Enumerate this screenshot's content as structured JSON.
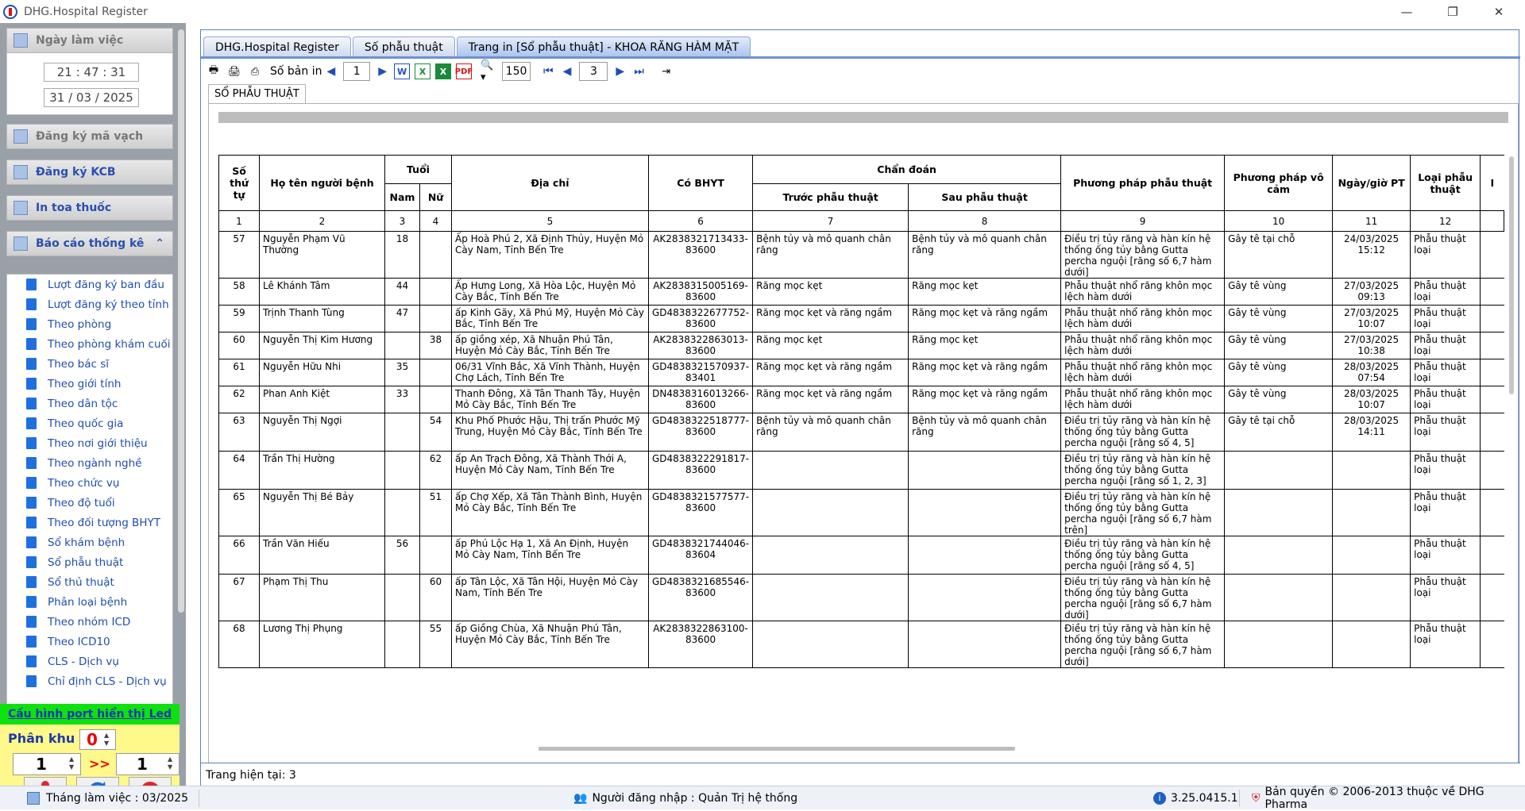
{
  "window": {
    "title": "DHG.Hospital Register",
    "controls": {
      "minimize": "—",
      "maximize": "❐",
      "close": "✕"
    }
  },
  "left": {
    "working_day_header": "Ngày làm việc",
    "time": "21 : 47 : 31",
    "date": "31 / 03 / 2025",
    "barcode_header": "Đăng ký mã vạch",
    "kcb_header": "Đăng ký KCB",
    "prescription_header": "In toa thuốc",
    "report_header": "Báo cáo thống kê",
    "report_items": [
      {
        "label": "Lượt đăng ký ban đầu"
      },
      {
        "label": "Lượt đăng ký theo tỉnh"
      },
      {
        "label": "Theo phòng"
      },
      {
        "label": "Theo phòng khám cuối"
      },
      {
        "label": "Theo bác sĩ"
      },
      {
        "label": "Theo giới tính"
      },
      {
        "label": "Theo dân tộc"
      },
      {
        "label": "Theo quốc gia"
      },
      {
        "label": "Theo nơi giới thiệu"
      },
      {
        "label": "Theo ngành nghề"
      },
      {
        "label": "Theo chức vụ"
      },
      {
        "label": "Theo độ tuổi"
      },
      {
        "label": "Theo đối tượng BHYT"
      },
      {
        "label": "Sổ khám bệnh"
      },
      {
        "label": "Sổ phẫu thuật"
      },
      {
        "label": "Sổ thủ thuật"
      },
      {
        "label": "Phân loại bệnh"
      },
      {
        "label": "Theo nhóm ICD"
      },
      {
        "label": "Theo ICD10"
      },
      {
        "label": "CLS - Dịch vụ"
      },
      {
        "label": "Chỉ định CLS - Dịch vụ"
      }
    ],
    "led_link": "Cấu hình port hiển thị Led",
    "phan_khu_label": "Phân khu :",
    "phan_khu_value": "0",
    "from_value": "1",
    "arrow_text": ">>",
    "to_value": "1"
  },
  "tabs": [
    {
      "label": "DHG.Hospital Register"
    },
    {
      "label": "Số phẫu thuật"
    },
    {
      "label": "Trang in [Sổ phẫu thuật] - KHOA RĂNG HÀM MẶT"
    }
  ],
  "toolbar": {
    "copies_label": "Số bản in",
    "copies_value": "1",
    "zoom_value": "150",
    "page_value": "3"
  },
  "subtab_label": "SỔ PHẪU THUẬT",
  "report": {
    "headers": {
      "stt": "Số thứ tự",
      "name": "Họ tên người bệnh",
      "age": "Tuổi",
      "male": "Nam",
      "female": "Nữ",
      "address": "Địa chỉ",
      "bhyt": "Có BHYT",
      "diagnosis": "Chẩn đoán",
      "before": "Trước phẫu thuật",
      "after": "Sau phẫu thuật",
      "method": "Phương pháp phẫu thuật",
      "anesthesia": "Phương pháp vô cảm",
      "datetime": "Ngày/giờ PT",
      "type": "Loại phẫu thuật",
      "extra": "I"
    },
    "col_numbers": [
      "1",
      "2",
      "3",
      "4",
      "5",
      "6",
      "7",
      "8",
      "9",
      "10",
      "11",
      "12",
      ""
    ],
    "rows": [
      {
        "stt": "57",
        "name": "Nguyễn Phạm Vũ Thường",
        "male": "18",
        "female": "",
        "address": "Ấp Hoà Phú 2, Xã Định Thủy, Huyện Mỏ Cày Nam, Tỉnh Bến Tre",
        "bhyt": "AK2838321713433-83600",
        "before": "Bệnh tủy và mô quanh chân răng",
        "after": "Bệnh tủy và mô quanh chân răng",
        "method": "Điều trị tủy răng và hàn kín hệ thống ống tủy bằng Gutta percha nguội [răng số 6,7 hàm dưới]",
        "anes": "Gây tê tại chỗ",
        "dt": "24/03/2025 15:12",
        "type": "Phẫu thuật loại"
      },
      {
        "stt": "58",
        "name": "Lê Khánh Tâm",
        "male": "44",
        "female": "",
        "address": "Ấp Hưng Long, Xã Hòa Lộc, Huyện Mỏ Cày Bắc, Tỉnh Bến Tre",
        "bhyt": "AK2838315005169-83600",
        "before": "Răng mọc kẹt",
        "after": "Răng mọc kẹt",
        "method": "Phẫu thuật nhổ răng khôn mọc lệch hàm dưới",
        "anes": "Gây tê vùng",
        "dt": "27/03/2025 09:13",
        "type": "Phẫu thuật loại"
      },
      {
        "stt": "59",
        "name": "Trịnh Thanh Tùng",
        "male": "47",
        "female": "",
        "address": "ấp Kinh Gãy, Xã Phú Mỹ, Huyện Mỏ Cày Bắc, Tỉnh Bến Tre",
        "bhyt": "GD4838322677752-83600",
        "before": "Răng mọc kẹt và răng ngầm",
        "after": "Răng mọc kẹt và răng ngầm",
        "method": "Phẫu thuật nhổ răng khôn mọc lệch hàm dưới",
        "anes": "Gây tê vùng",
        "dt": "27/03/2025 10:07",
        "type": "Phẫu thuật loại"
      },
      {
        "stt": "60",
        "name": "Nguyễn Thị Kim Hương",
        "male": "",
        "female": "38",
        "address": "ấp giồng xép, Xã Nhuận Phú Tân, Huyện Mỏ Cày Bắc, Tỉnh Bến Tre",
        "bhyt": "AK2838322863013-83600",
        "before": "Răng mọc kẹt",
        "after": "Răng mọc kẹt",
        "method": "Phẫu thuật nhổ răng khôn mọc lệch hàm dưới",
        "anes": "Gây tê vùng",
        "dt": "27/03/2025 10:38",
        "type": "Phẫu thuật loại"
      },
      {
        "stt": "61",
        "name": "Nguyễn Hữu Nhi",
        "male": "35",
        "female": "",
        "address": "06/31 Vĩnh Bắc, Xã Vĩnh Thành, Huyện Chợ Lách, Tỉnh Bến Tre",
        "bhyt": "GD4838321570937-83401",
        "before": "Răng mọc kẹt và răng ngầm",
        "after": "Răng mọc kẹt và răng ngầm",
        "method": "Phẫu thuật nhổ răng khôn mọc lệch hàm dưới",
        "anes": "Gây tê vùng",
        "dt": "28/03/2025 07:54",
        "type": "Phẫu thuật loại"
      },
      {
        "stt": "62",
        "name": "Phan Anh Kiệt",
        "male": "33",
        "female": "",
        "address": "Thanh Đông, Xã Tân Thanh Tây, Huyện Mỏ Cày Bắc, Tỉnh Bến Tre",
        "bhyt": "DN4838316013266-83600",
        "before": "Răng mọc kẹt và răng ngầm",
        "after": "Răng mọc kẹt và răng ngầm",
        "method": "Phẫu thuật nhổ răng khôn mọc lệch hàm dưới",
        "anes": "Gây tê vùng",
        "dt": "28/03/2025 10:07",
        "type": "Phẫu thuật loại"
      },
      {
        "stt": "63",
        "name": "Nguyễn Thị Ngợi",
        "male": "",
        "female": "54",
        "address": "Khu Phố Phước Hậu, Thị trấn Phước Mỹ Trung, Huyện Mỏ Cày Bắc, Tỉnh Bến Tre",
        "bhyt": "GD4838322518777-83600",
        "before": "Bệnh tủy và mô quanh chân răng",
        "after": "Bệnh tủy và mô quanh chân răng",
        "method": "Điều trị tủy răng và hàn kín hệ thống ống tủy bằng Gutta percha nguội [răng số 4, 5]",
        "anes": "Gây tê tại chỗ",
        "dt": "28/03/2025 14:11",
        "type": "Phẫu thuật loại"
      },
      {
        "stt": "64",
        "name": "Trần Thị Hường",
        "male": "",
        "female": "62",
        "address": "ấp An Trạch Đông, Xã Thành Thới A, Huyện Mỏ Cày Nam, Tỉnh Bến Tre",
        "bhyt": "GD4838322291817-83600",
        "before": "",
        "after": "",
        "method": "Điều trị tủy răng và hàn kín hệ thống ống tủy bằng Gutta percha nguội [răng số 1, 2, 3]",
        "anes": "",
        "dt": "",
        "type": "Phẫu thuật loại"
      },
      {
        "stt": "65",
        "name": "Nguyễn Thị Bé Bảy",
        "male": "",
        "female": "51",
        "address": "ấp Chợ Xếp, Xã Tân Thành Bình, Huyện Mỏ Cày Bắc, Tỉnh Bến Tre",
        "bhyt": "GD4838321577577-83600",
        "before": "",
        "after": "",
        "method": "Điều trị tủy răng và hàn kín hệ thống ống tủy bằng Gutta percha nguội [răng số 6,7 hàm trên]",
        "anes": "",
        "dt": "",
        "type": "Phẫu thuật loại"
      },
      {
        "stt": "66",
        "name": "Trần Văn Hiếu",
        "male": "56",
        "female": "",
        "address": "ấp Phú Lộc Hạ 1, Xã An Định, Huyện Mỏ Cày Nam, Tỉnh Bến Tre",
        "bhyt": "GD4838321744046-83604",
        "before": "",
        "after": "",
        "method": "Điều trị tủy răng và hàn kín hệ thống ống tủy bằng Gutta percha nguội [răng số 4, 5]",
        "anes": "",
        "dt": "",
        "type": "Phẫu thuật loại"
      },
      {
        "stt": "67",
        "name": "Phạm Thị Thu",
        "male": "",
        "female": "60",
        "address": "ấp Tân Lộc, Xã Tân Hội, Huyện Mỏ Cày Nam, Tỉnh Bến Tre",
        "bhyt": "GD4838321685546-83600",
        "before": "",
        "after": "",
        "method": "Điều trị tủy răng và hàn kín hệ thống ống tủy bằng Gutta percha nguội [răng số 6,7 hàm dưới]",
        "anes": "",
        "dt": "",
        "type": "Phẫu thuật loại"
      },
      {
        "stt": "68",
        "name": "Lương Thị Phụng",
        "male": "",
        "female": "55",
        "address": "ấp Giồng Chùa, Xã Nhuận Phú Tân, Huyện Mỏ Cày Bắc, Tỉnh Bến Tre",
        "bhyt": "AK2838322863100-83600",
        "before": "",
        "after": "",
        "method": "Điều trị tủy răng và hàn kín hệ thống ống tủy bằng Gutta percha nguội [răng số 6,7 hàm dưới]",
        "anes": "",
        "dt": "",
        "type": "Phẫu thuật loại"
      }
    ]
  },
  "current_page_label": "Trang hiện tại:",
  "current_page_value": "3",
  "statusbar": {
    "month": "Tháng làm việc : 03/2025",
    "user": "Người đăng nhập : Quản Trị hệ thống",
    "version": "3.25.0415.1",
    "copyright": "Bản quyền © 2006-2013 thuộc về DHG Pharma"
  }
}
